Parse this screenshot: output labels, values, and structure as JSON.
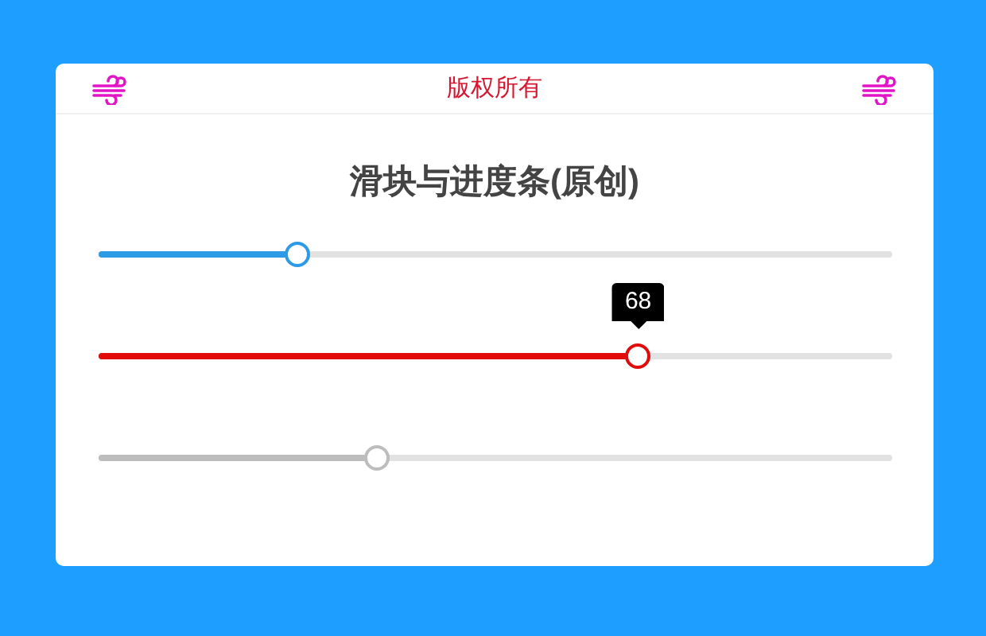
{
  "header": {
    "title": "版权所有"
  },
  "heading": "滑块与进度条(原创)",
  "sliders": [
    {
      "level": 0.25,
      "color": "#2d9ae6",
      "disabled": false
    },
    {
      "level": 0.68,
      "color": "#e00b0b",
      "disabled": false,
      "tooltip": "68"
    },
    {
      "level": 0.35,
      "color": "#bdbdbd",
      "disabled": true
    }
  ]
}
